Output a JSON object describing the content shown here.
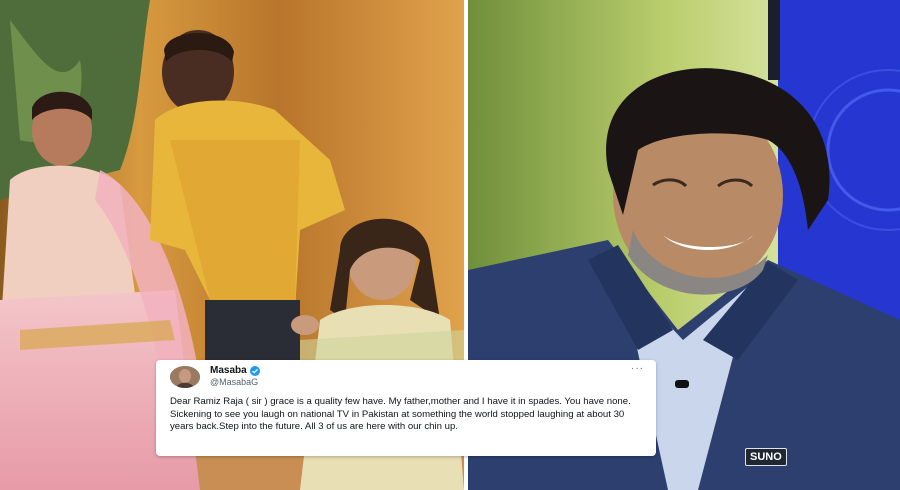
{
  "tweet": {
    "display_name": "Masaba",
    "handle": "@MasabaG",
    "more_glyph": "···",
    "text": "Dear Ramiz Raja ( sir ) grace is a quality few have. My father,mother and I have it in spades. You have none. Sickening to see you laugh on national TV in Pakistan at something the world stopped laughing at about 30 years back.Step into the future. All 3 of us are here with our chin up."
  },
  "jersey_logo": "SUNO",
  "colors": {
    "verified": "#1d9bf0",
    "card_bg": "#ffffff",
    "text": "#0f1419",
    "handle": "#536471"
  }
}
